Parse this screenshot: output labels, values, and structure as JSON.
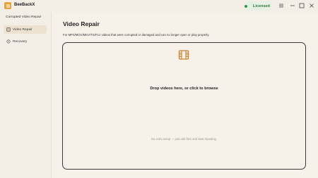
{
  "app": {
    "name": "BeeBackX",
    "license_label": "Licensed"
  },
  "sidebar": {
    "heading": "Corrupted Video Repair",
    "items": [
      {
        "label": "Video Repair",
        "icon": "film-icon",
        "active": true
      },
      {
        "label": "Recovery",
        "icon": "recovery-icon",
        "active": false
      }
    ]
  },
  "main": {
    "title": "Video Repair",
    "description": "For MP4/MOV/MKV/TS/FLV videos that were corrupted or damaged and can no longer open or play properly.",
    "dropzone": {
      "title": "Drop videos here, or click to browse",
      "hint": "No extra setup — just add files and start repairing."
    }
  },
  "colors": {
    "accent": "#e6a33b",
    "license_green": "#2e9a45",
    "background": "#f6f2ea"
  }
}
